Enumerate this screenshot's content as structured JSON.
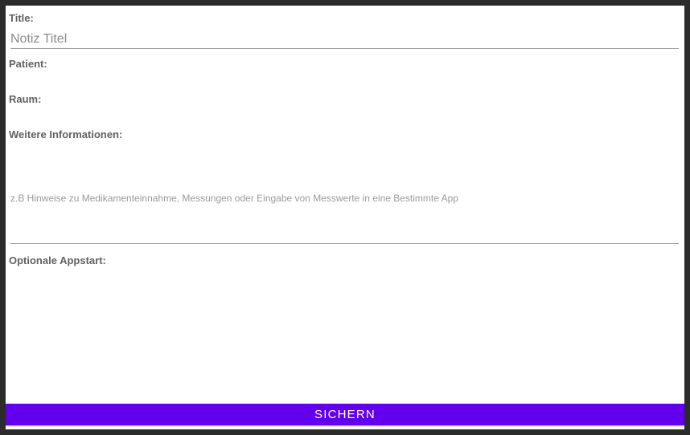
{
  "form": {
    "title_label": "Title:",
    "title_placeholder": "Notiz Titel",
    "title_value": "",
    "patient_label": "Patient:",
    "room_label": "Raum:",
    "info_label": "Weitere Informationen:",
    "info_placeholder": "z.B Hinweise zu Medikamenteinnahme, Messungen oder Eingabe von Messwerte in eine Bestimmte App",
    "info_value": "",
    "app_start_label": "Optionale Appstart:"
  },
  "actions": {
    "save_label": "SICHERN"
  },
  "colors": {
    "primary": "#6200ee",
    "label": "#616161",
    "underline": "#9e9e9e"
  }
}
